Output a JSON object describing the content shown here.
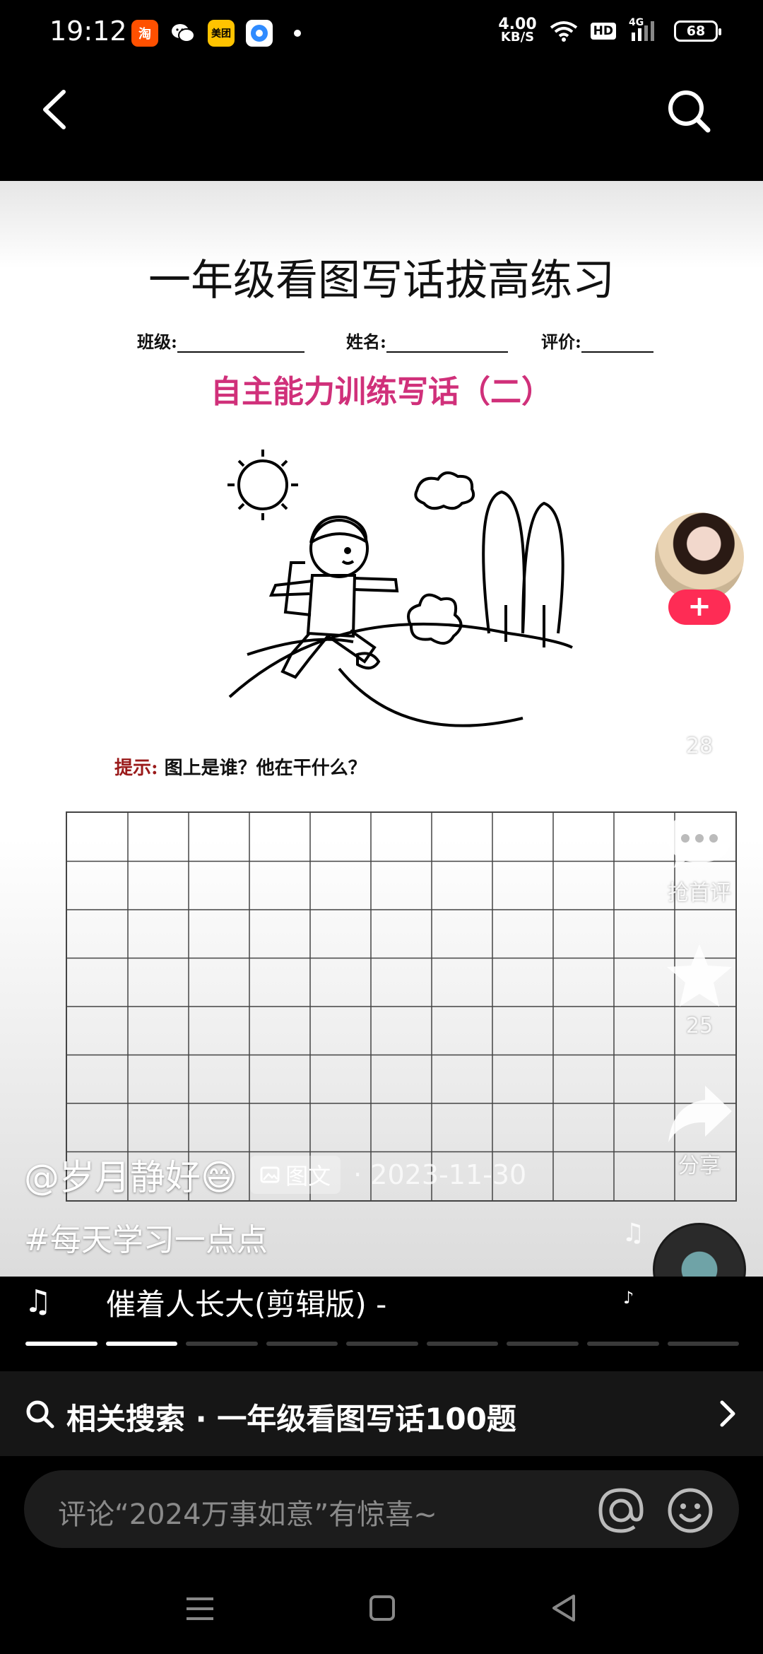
{
  "status_bar": {
    "time": "19:12",
    "app_icons": [
      {
        "name": "taobao-icon",
        "text": "淘",
        "color": "#ff5000"
      },
      {
        "name": "wechat-icon",
        "text": "",
        "color": "#000000"
      },
      {
        "name": "meituan-icon",
        "text": "美团",
        "color": "#ffc300"
      },
      {
        "name": "browser-icon",
        "text": "",
        "color": "#2f8bff"
      }
    ],
    "net_speed_value": "4.00",
    "net_speed_unit": "KB/S",
    "hd_label": "HD",
    "signal_label": "4G",
    "battery": "68"
  },
  "worksheet": {
    "title": "一年级看图写话拔高练习",
    "class_label": "班级:",
    "name_label": "姓名:",
    "eval_label": "评价:",
    "subtitle": "自主能力训练写话（二）",
    "hint_label": "提示:",
    "hint_text": "图上是谁？他在干什么？",
    "grid_columns": 11,
    "grid_rows": 8
  },
  "actions": {
    "likes": "28",
    "comment_label": "抢首评",
    "favorites": "25",
    "share_label": "分享"
  },
  "post": {
    "author": "@岁月静好😄",
    "type_badge": "图文",
    "date": "· 2023-11-30",
    "hashtag": "#每天学习一点点",
    "music_title": "催着人长大(剪辑版) -",
    "progress_segments": 9,
    "progress_active": 2
  },
  "related_search": {
    "text": "相关搜索 · 一年级看图写话100题"
  },
  "comment": {
    "placeholder": "评论“2024万事如意”有惊喜~"
  },
  "colors": {
    "accent": "#fe2c55",
    "subtitle": "#d0307a"
  }
}
